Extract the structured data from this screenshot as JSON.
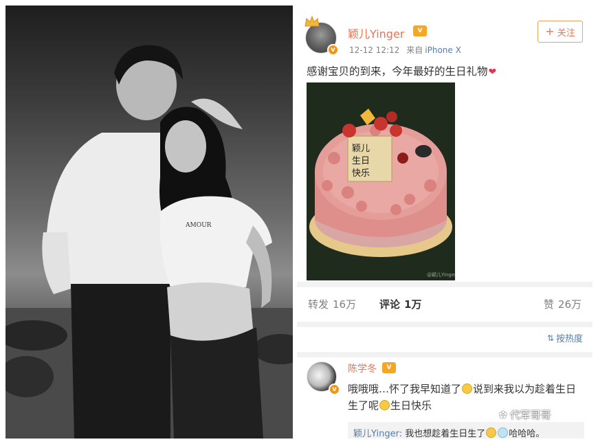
{
  "post": {
    "username": "颖儿Yinger",
    "vip_label": "V",
    "timestamp": "12-12 12:12",
    "from_label": "来自",
    "source": "iPhone X",
    "follow_plus": "+",
    "follow_label": "关注",
    "text": "感谢宝贝的到来，今年最好的生日礼物",
    "heart_icon": "heart-icon",
    "image_description_icon": "birthday-cake-photo"
  },
  "stats": {
    "repost_label": "转发",
    "repost_count": "16万",
    "comment_label": "评论",
    "comment_count": "1万",
    "like_label": "赞",
    "like_count": "26万"
  },
  "sort": {
    "icon": "sort-icon",
    "label": "按热度"
  },
  "comment": {
    "username": "陈学冬",
    "text_part1": "哦哦哦…怀了我早知道了",
    "text_part2": "说到来我以为趁着生日生了呢",
    "text_part3": "生日快乐",
    "reply_name": "颖儿Yinger:",
    "reply_text": " 我也想趁着生日生了",
    "reply_tail": "哈哈哈。"
  },
  "watermark": {
    "icon": "wechat-icon",
    "text": "代军哥哥"
  },
  "colors": {
    "orange": "#eb7350",
    "link_blue": "#507daf",
    "separator": "#f2f2f2",
    "vip": "#f6a623",
    "heart": "#e5334d"
  }
}
